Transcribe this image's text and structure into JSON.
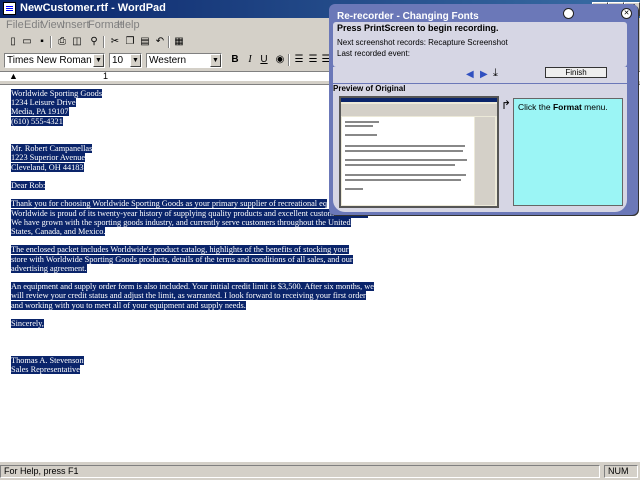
{
  "window": {
    "title": "NewCustomer.rtf - WordPad",
    "buttons": {
      "minimize": "_",
      "maximize": "□",
      "close": "X"
    }
  },
  "menu": [
    "File",
    "Edit",
    "View",
    "Insert",
    "Format",
    "Help"
  ],
  "toolbar": {
    "icons": [
      "new-icon",
      "open-icon",
      "save-icon",
      "print-icon",
      "print-preview-icon",
      "find-icon",
      "cut-icon",
      "copy-icon",
      "paste-icon",
      "undo-icon",
      "date-time-icon"
    ]
  },
  "format": {
    "font": "Times New Roman",
    "size": "10",
    "script": "Western",
    "bold": "B",
    "italic": "I",
    "underline": "U"
  },
  "ruler": {
    "numbers": [
      "1"
    ]
  },
  "document": {
    "lines": [
      "Worldwide Sporting Goods",
      "1234 Leisure Drive",
      "Media, PA 19107",
      "(610) 555-4321",
      "",
      "",
      "Mr. Robert Campanellas",
      "1223 Superior Avenue",
      "Cleveland, OH 44183",
      "",
      "Dear Rob:",
      "",
      "Thank you for choosing Worldwide Sporting Goods as your primary supplier of recreational eq",
      "Worldwide is proud of its twenty-year history of supplying quality products and excellent customer service.",
      "We have grown with the sporting goods industry, and currently serve customers throughout the United",
      "States, Canada, and Mexico.",
      "",
      "The enclosed packet includes Worldwide's product catalog, highlights of the benefits of stocking your",
      "store with Worldwide Sporting Goods products, details of the terms and conditions of all sales, and our",
      "advertising agreement.",
      "",
      "An equipment and supply order form is also included. Your initial credit limit is $3,500. After six months, we",
      "will review your credit status and adjust the limit, as warranted. I look forward to receiving your first order",
      "and working with you to meet all of your equipment and supply needs.",
      "",
      "Sincerely,",
      "",
      "",
      "",
      "Thomas A. Stevenson",
      "Sales Representative"
    ]
  },
  "status": {
    "help": "For Help, press F1",
    "num": "NUM"
  },
  "recorder": {
    "title": "Re-recorder - Changing Fonts",
    "prompt": "Press PrintScreen to begin recording.",
    "next": "Next screenshot records: Recapture Screenshot",
    "last": "Last recorded event:",
    "finish": "Finish",
    "preview_title": "Preview of Original",
    "instruction_pre": "Click the ",
    "instruction_bold": "Format",
    "instruction_post": " menu."
  }
}
